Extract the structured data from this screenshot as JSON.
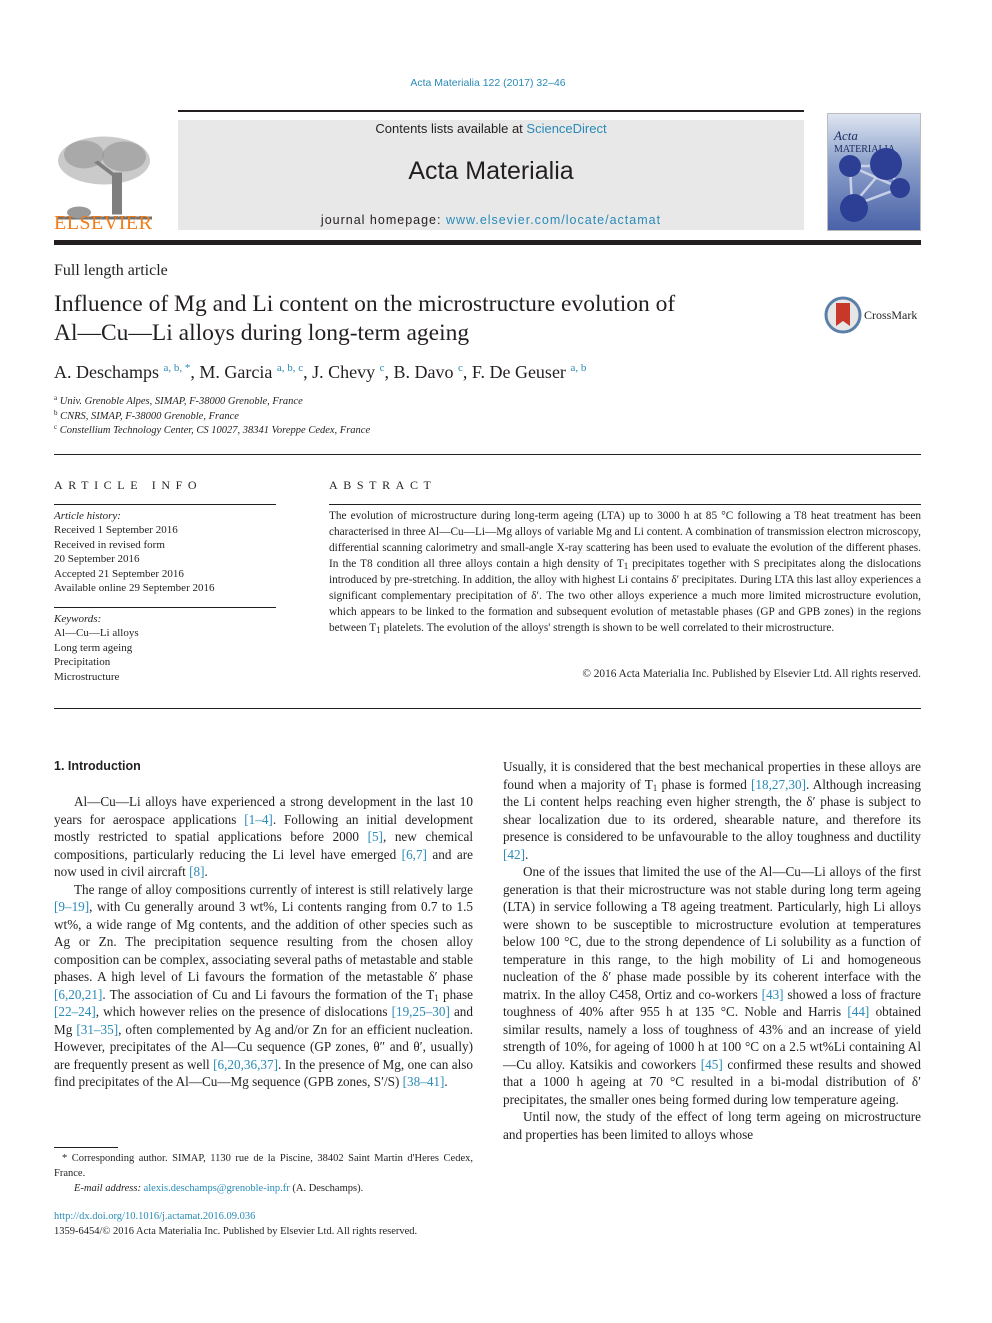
{
  "header": {
    "citation": "Acta Materialia 122 (2017) 32–46",
    "contents_prefix": "Contents lists available at ",
    "contents_link": "ScienceDirect",
    "journal_title": "Acta Materialia",
    "homepage_prefix": "journal homepage: ",
    "homepage_link": "www.elsevier.com/locate/actamat",
    "publisher_logo": "ELSEVIER",
    "cover_title_italic": "Acta",
    "cover_title_rest": " MATERIALIA",
    "accent_color": "#2a8ab8",
    "publisher_color": "#f07d1a"
  },
  "article": {
    "type": "Full length article",
    "title_line1": "Influence of Mg and Li content on the microstructure evolution of",
    "title_line2": "Al—Cu—Li alloys during long-term ageing",
    "crossmark_label": "CrossMark",
    "authors": [
      {
        "name": "A. Deschamps",
        "affil": "a, b, *"
      },
      {
        "name": "M. Garcia",
        "affil": "a, b, c"
      },
      {
        "name": "J. Chevy",
        "affil": "c"
      },
      {
        "name": "B. Davo",
        "affil": "c"
      },
      {
        "name": "F. De Geuser",
        "affil": "a, b"
      }
    ],
    "affiliations": [
      {
        "key": "a",
        "text": "Univ. Grenoble Alpes, SIMAP, F-38000 Grenoble, France"
      },
      {
        "key": "b",
        "text": "CNRS, SIMAP, F-38000 Grenoble, France"
      },
      {
        "key": "c",
        "text": "Constellium Technology Center, CS 10027, 38341 Voreppe Cedex, France"
      }
    ]
  },
  "article_info": {
    "heading": "ARTICLE INFO",
    "history_label": "Article history:",
    "history": [
      "Received 1 September 2016",
      "Received in revised form",
      "20 September 2016",
      "Accepted 21 September 2016",
      "Available online 29 September 2016"
    ],
    "keywords_label": "Keywords:",
    "keywords": [
      "Al—Cu—Li alloys",
      "Long term ageing",
      "Precipitation",
      "Microstructure"
    ]
  },
  "abstract": {
    "heading": "ABSTRACT",
    "p1": "The evolution of microstructure during long-term ageing (LTA) up to 3000 h at 85 °C following a T8 heat treatment has been characterised in three Al—Cu—Li—Mg alloys of variable Mg and Li content. A combination of transmission electron microscopy, differential scanning calorimetry and small-angle X-ray scattering has been used to evaluate the evolution of the different phases. In the T8 condition all three alloys contain a high density of T",
    "p2": " precipitates together with S precipitates along the dislocations introduced by pre-stretching. In addition, the alloy with highest Li contains δ′ precipitates. During LTA this last alloy experiences a significant complementary precipitation of δ′. The two other alloys experience a much more limited microstructure evolution, which appears to be linked to the formation and subsequent evolution of metastable phases (GP and GPB zones) in the regions between T",
    "p3": " platelets. The evolution of the alloys' strength is shown to be well correlated to their microstructure.",
    "sub": "1",
    "copyright": "© 2016 Acta Materialia Inc. Published by Elsevier Ltd. All rights reserved."
  },
  "body": {
    "section_heading": "1.  Introduction",
    "left": [
      {
        "t": "Al—Cu—Li alloys have experienced a strong development in the last 10 years for aerospace applications "
      },
      {
        "r": "[1–4]"
      },
      {
        "t": ". Following an initial development mostly restricted to spatial applications before 2000 "
      },
      {
        "r": "[5]"
      },
      {
        "t": ", new chemical compositions, particularly reducing the Li level have emerged "
      },
      {
        "r": "[6,7]"
      },
      {
        "t": " and are now used in civil aircraft "
      },
      {
        "r": "[8]"
      },
      {
        "t": "."
      },
      {
        "p": true
      },
      {
        "t": "The range of alloy compositions currently of interest is still relatively large "
      },
      {
        "r": "[9–19]"
      },
      {
        "t": ", with Cu generally around 3 wt%, Li contents ranging from 0.7 to 1.5 wt%, a wide range of Mg contents, and the addition of other species such as Ag or Zn. The precipitation sequence resulting from the chosen alloy composition can be complex, associating several paths of metastable and stable phases. A high level of Li favours the formation of the metastable δ′ phase "
      },
      {
        "r": "[6,20,21]"
      },
      {
        "t": ". The association of Cu and Li favours the formation of the T"
      },
      {
        "s": "1"
      },
      {
        "t": " phase "
      },
      {
        "r": "[22–24]"
      },
      {
        "t": ", which however relies on the presence of dislocations "
      },
      {
        "r": "[19,25–30]"
      },
      {
        "t": " and Mg "
      },
      {
        "r": "[31–35]"
      },
      {
        "t": ", often complemented by Ag and/or Zn for an efficient nucleation. However, precipitates of the Al—Cu sequence (GP zones, θ″ and θ′, usually) are frequently present as well "
      },
      {
        "r": "[6,20,36,37]"
      },
      {
        "t": ". In the presence of Mg, one can also find precipitates of the Al—Cu—Mg sequence (GPB zones, S′/S) "
      },
      {
        "r": "[38–41]"
      },
      {
        "t": "."
      }
    ],
    "right": [
      {
        "t": "Usually, it is considered that the best mechanical properties in these alloys are found when a majority of T"
      },
      {
        "s": "1"
      },
      {
        "t": " phase is formed "
      },
      {
        "r": "[18,27,30]"
      },
      {
        "t": ". Although increasing the Li content helps reaching even higher strength, the δ′ phase is subject to shear localization due to its ordered, shearable nature, and therefore its presence is considered to be unfavourable to the alloy toughness and ductility "
      },
      {
        "r": "[42]"
      },
      {
        "t": "."
      },
      {
        "p": true
      },
      {
        "t": "One of the issues that limited the use of the Al—Cu—Li alloys of the first generation is that their microstructure was not stable during long term ageing (LTA) in service following a T8 ageing treatment. Particularly, high Li alloys were shown to be susceptible to microstructure evolution at temperatures below 100 °C, due to the strong dependence of Li solubility as a function of temperature in this range, to the high mobility of Li and homogeneous nucleation of the δ′ phase made possible by its coherent interface with the matrix. In the alloy C458, Ortiz and co-workers "
      },
      {
        "r": "[43]"
      },
      {
        "t": " showed a loss of fracture toughness of 40% after 955 h at 135 °C. Noble and Harris "
      },
      {
        "r": "[44]"
      },
      {
        "t": " obtained similar results, namely a loss of toughness of 43% and an increase of yield strength of 10%, for ageing of 1000 h at 100 °C on a 2.5 wt%Li containing Al—Cu alloy. Katsikis and coworkers "
      },
      {
        "r": "[45]"
      },
      {
        "t": " confirmed these results and showed that a 1000 h ageing at 70 °C resulted in a bi-modal distribution of δ′ precipitates, the smaller ones being formed during low temperature ageing."
      },
      {
        "p": true
      },
      {
        "t": "Until now, the study of the effect of long term ageing on microstructure and properties has been limited to alloys whose"
      }
    ]
  },
  "footer": {
    "corresponding": "* Corresponding author. SIMAP, 1130 rue de la Piscine, 38402 Saint Martin d'Heres Cedex, France.",
    "email_label": "E-mail address: ",
    "email": "alexis.deschamps@grenoble-inp.fr",
    "email_suffix": " (A. Deschamps).",
    "doi": "http://dx.doi.org/10.1016/j.actamat.2016.09.036",
    "issn": "1359-6454/© 2016 Acta Materialia Inc. Published by Elsevier Ltd. All rights reserved."
  }
}
